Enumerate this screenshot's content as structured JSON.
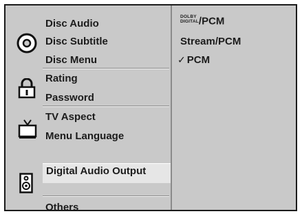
{
  "menu": {
    "groups": [
      {
        "icon": "disc-icon",
        "items": [
          "Disc Audio",
          "Disc Subtitle",
          "Disc Menu"
        ]
      },
      {
        "icon": "lock-icon",
        "items": [
          "Rating",
          "Password"
        ]
      },
      {
        "icon": "tv-icon",
        "items": [
          "TV Aspect",
          "Menu Language"
        ]
      },
      {
        "icon": "speaker-icon",
        "items": [
          "Digital Audio Output"
        ]
      },
      {
        "icon": "none",
        "items": [
          "Others"
        ]
      }
    ],
    "selected": "Digital Audio Output"
  },
  "options": {
    "dolby_logo": {
      "line1": "DOLBY",
      "line2": "DIGITAL"
    },
    "items": [
      "/PCM",
      "Stream/PCM",
      "PCM"
    ],
    "checked": "PCM",
    "check_glyph": "✓"
  }
}
